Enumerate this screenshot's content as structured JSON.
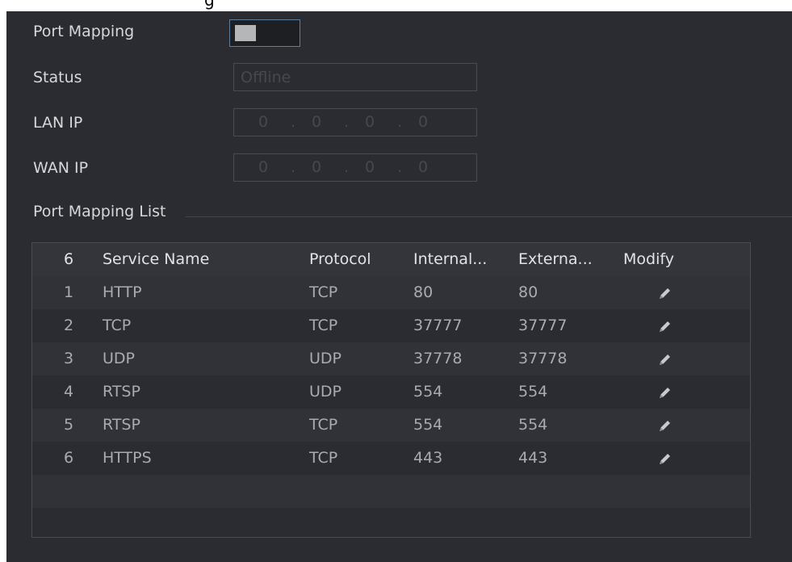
{
  "top_cut_text": "g",
  "form": {
    "port_mapping_label": "Port Mapping",
    "status_label": "Status",
    "status_value": "Offline",
    "lan_ip_label": "LAN IP",
    "lan_ip": [
      "0",
      "0",
      "0",
      "0"
    ],
    "wan_ip_label": "WAN IP",
    "wan_ip": [
      "0",
      "0",
      "0",
      "0"
    ]
  },
  "list_title": "Port Mapping List",
  "table": {
    "headers": {
      "no": "6",
      "service": "Service Name",
      "protocol": "Protocol",
      "internal": "Internal...",
      "external": "Externa...",
      "modify": "Modify"
    },
    "rows": [
      {
        "no": "1",
        "service": "HTTP",
        "protocol": "TCP",
        "internal": "80",
        "external": "80"
      },
      {
        "no": "2",
        "service": "TCP",
        "protocol": "TCP",
        "internal": "37777",
        "external": "37777"
      },
      {
        "no": "3",
        "service": "UDP",
        "protocol": "UDP",
        "internal": "37778",
        "external": "37778"
      },
      {
        "no": "4",
        "service": "RTSP",
        "protocol": "UDP",
        "internal": "554",
        "external": "554"
      },
      {
        "no": "5",
        "service": "RTSP",
        "protocol": "TCP",
        "internal": "554",
        "external": "554"
      },
      {
        "no": "6",
        "service": "HTTPS",
        "protocol": "TCP",
        "internal": "443",
        "external": "443"
      }
    ]
  },
  "icons": {
    "edit": "pencil-icon"
  },
  "colors": {
    "background": "#2b2c31",
    "text": "#d6d7d9",
    "toggle_border": "#5c7fa0"
  }
}
